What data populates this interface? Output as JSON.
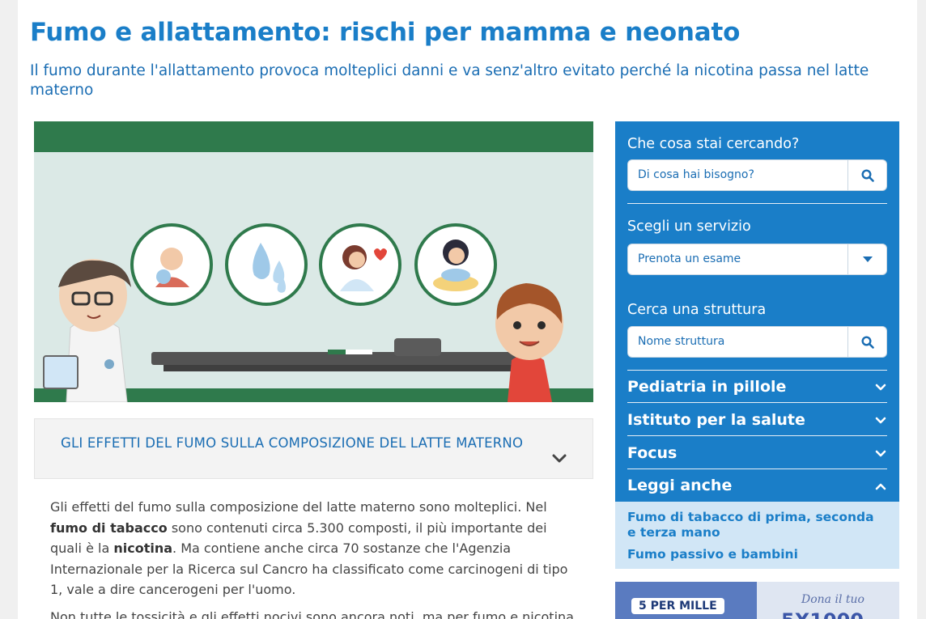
{
  "header": {
    "title": "Fumo e allattamento: rischi per mamma e neonato",
    "subtitle": "Il fumo durante l'allattamento provoca molteplici danni e va senz'altro evitato perché la nicotina passa nel latte materno"
  },
  "accordion": {
    "title": "GLI EFFETTI DEL FUMO SULLA COMPOSIZIONE DEL LATTE MATERNO"
  },
  "article": {
    "p1": {
      "t1": "Gli effetti del fumo sulla composizione del latte materno sono molteplici. Nel ",
      "b1": "fumo di tabacco",
      "t2": " sono contenuti circa 5.300 composti, il più importante dei quali è la ",
      "b2": "nicotina",
      "t3": ". Ma contiene anche circa 70 sostanze che l'Agenzia Internazionale per la Ricerca sul Cancro ha classificato come carcinogeni di tipo 1, vale a dire cancerogeni per l'uomo."
    },
    "p2": "Non tutte le tossicità e gli effetti nocivi sono ancora noti, ma per fumo e nicotina"
  },
  "sidebar": {
    "search": {
      "label": "Che cosa stai cercando?",
      "placeholder": "Di cosa hai bisogno?"
    },
    "service": {
      "label": "Scegli un servizio",
      "selected": "Prenota un esame"
    },
    "structure": {
      "label": "Cerca una struttura",
      "placeholder": "Nome struttura"
    },
    "sections": [
      {
        "label": "Pediatria in pillole",
        "expanded": false
      },
      {
        "label": "Istituto per la salute",
        "expanded": false
      },
      {
        "label": "Focus",
        "expanded": false
      },
      {
        "label": "Leggi anche",
        "expanded": true
      }
    ],
    "related_links": [
      "Fumo di tabacco di prima, seconda e terza mano",
      "Fumo passivo e bambini"
    ]
  },
  "banner": {
    "badge": "5 PER MILLE",
    "script_text": "Dona il tuo",
    "big_text": "5X1000"
  },
  "colors": {
    "brand_blue": "#1a7ec8",
    "hero_green": "#2f7a4c",
    "light_blue_panel": "#d1e6f6"
  },
  "icons": [
    "search-icon",
    "caret-down-icon",
    "chevron-down-icon",
    "chevron-up-icon"
  ]
}
